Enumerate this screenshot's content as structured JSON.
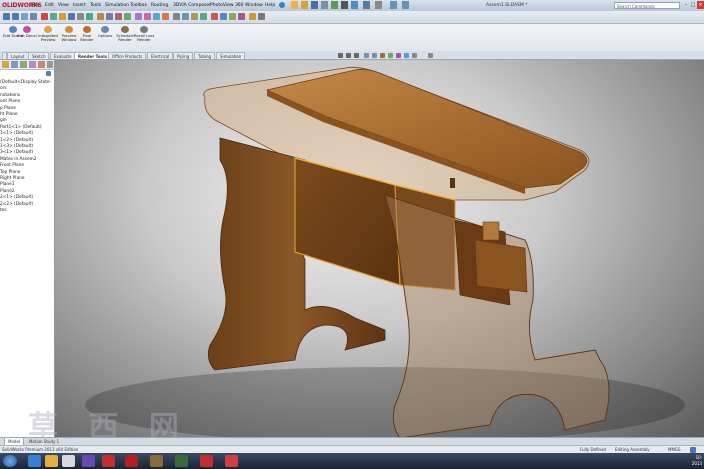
{
  "app": {
    "logo": "OLIDWORKS",
    "title": "Assem1.SLDASM *",
    "search_placeholder": "Search Commands"
  },
  "menu": [
    "File",
    "Edit",
    "View",
    "Insert",
    "Tools",
    "Simulation",
    "Toolbox",
    "Routing",
    "3DVIA Composer",
    "PhotoView 360",
    "Window",
    "Help"
  ],
  "command_manager": [
    {
      "label": "Edit Scene",
      "icon": "scene-icon"
    },
    {
      "label": "Edit Decal",
      "icon": "decal-icon"
    },
    {
      "label": "Integrated Preview",
      "icon": "preview-icon"
    },
    {
      "label": "Preview Window",
      "icon": "preview-window-icon"
    },
    {
      "label": "Final Render",
      "icon": "render-icon"
    },
    {
      "label": "Options",
      "icon": "options-icon"
    },
    {
      "label": "Schedule Render",
      "icon": "schedule-icon"
    },
    {
      "label": "Recall Last Render",
      "icon": "recall-icon"
    }
  ],
  "tabs": [
    "Layout",
    "Sketch",
    "Evaluate",
    "Render Tools",
    "Office Products",
    "Electrical",
    "Piping",
    "Tubing",
    "Simulation"
  ],
  "active_tab": "Render Tools",
  "tree": {
    "filter_label": "",
    "nodes": [
      "(Default<Display State-",
      "ors",
      "notations",
      "ont Plane",
      "p Plane",
      "ht Plane",
      "gin",
      "Part1<1> (Default)",
      "1<1> (Default)",
      "1<2> (Default)",
      "1<3> (Default)",
      "3<1> (Default)",
      "Mates in Assem2",
      "Front Plane",
      "Top Plane",
      "Right Plane",
      "Plane1",
      "Plane2",
      "2<1> (Default)",
      "2<2> (Default)",
      "tes"
    ]
  },
  "model_tabs": [
    "Model",
    "Motion Study 1"
  ],
  "status": {
    "left": "SolidWorks Premium 2013 x64 Edition",
    "defined": "Fully Defined",
    "mode": "Editing Assembly",
    "units": "MMGS"
  },
  "clock": {
    "time": "10:",
    "date": "2013"
  },
  "watermark": "草 西 网",
  "colors": {
    "wood_light": "#b07a3c",
    "wood_dark": "#6b3f17",
    "accent_red": "#c8102e",
    "taskbar": "#1f2a3e"
  }
}
